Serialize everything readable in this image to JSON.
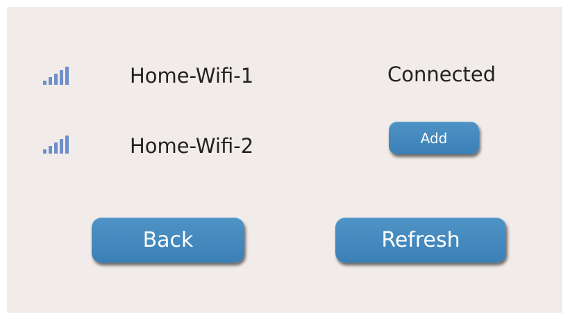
{
  "networks": [
    {
      "ssid": "Home-Wifi-1",
      "signal_icon": "wifi-signal-bars-icon",
      "status": "Connected"
    },
    {
      "ssid": "Home-Wifi-2",
      "signal_icon": "wifi-signal-bars-icon",
      "action_label": "Add"
    }
  ],
  "buttons": {
    "back_label": "Back",
    "refresh_label": "Refresh"
  },
  "colors": {
    "background": "#f1ece9",
    "button": "#4387bd",
    "signal_icon": "#6f8fc8",
    "text": "#222222"
  }
}
